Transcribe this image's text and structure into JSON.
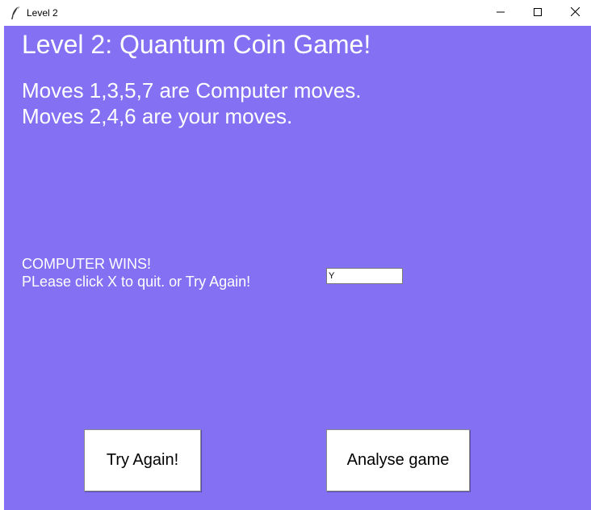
{
  "window": {
    "title": "Level 2",
    "icon": "feather-icon",
    "controls": [
      "minimize-icon",
      "maximize-icon",
      "close-icon"
    ]
  },
  "game": {
    "heading": "Level 2: Quantum Coin Game!",
    "rules_line1": "Moves 1,3,5,7 are Computer moves.",
    "rules_line2": "Moves 2,4,6 are your moves.",
    "status_line1": "COMPUTER WINS!",
    "status_line2": "PLease click X to quit. or Try Again!",
    "entry_value": "Y",
    "try_again_label": "Try Again!",
    "analyse_label": "Analyse game"
  },
  "colors": {
    "background": "#8470f2",
    "text": "#ffffff"
  }
}
